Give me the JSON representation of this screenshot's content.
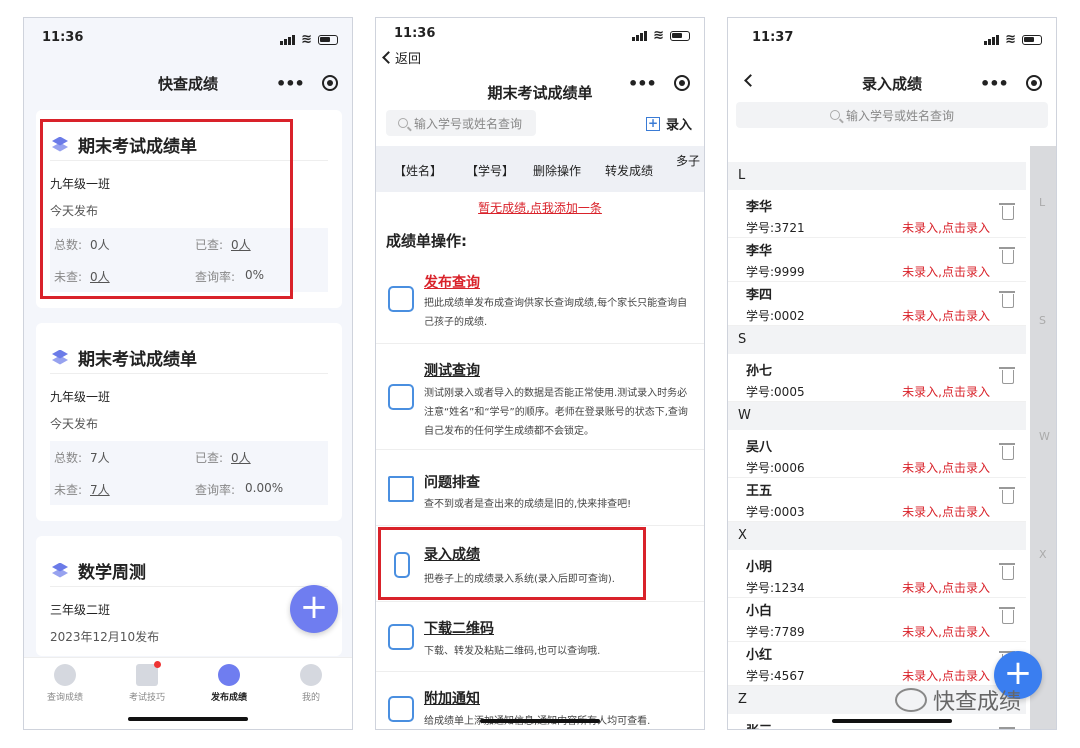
{
  "p1": {
    "time": "11:36",
    "title": "快查成绩",
    "cards": [
      {
        "title": "期末考试成绩单",
        "class": "九年级一班",
        "published": "今天发布",
        "total_label": "总数:",
        "total": "0人",
        "checked_label": "已查:",
        "checked": "0人",
        "unchecked_label": "未查:",
        "unchecked": "0人",
        "rate_label": "查询率:",
        "rate": "0%"
      },
      {
        "title": "期末考试成绩单",
        "class": "九年级一班",
        "published": "今天发布",
        "total_label": "总数:",
        "total": "7人",
        "checked_label": "已查:",
        "checked": "0人",
        "unchecked_label": "未查:",
        "unchecked": "7人",
        "rate_label": "查询率:",
        "rate": "0.00%"
      },
      {
        "title": "数学周测",
        "class": "三年级二班",
        "published": "2023年12月10发布"
      }
    ],
    "tabs": [
      "查询成绩",
      "考试技巧",
      "发布成绩",
      "我的"
    ]
  },
  "p2": {
    "time": "11:36",
    "back": "返回",
    "title": "期末考试成绩单",
    "search_placeholder": "输入学号或姓名查询",
    "add_label": "录入",
    "columns": [
      "【姓名】",
      "【学号】",
      "删除操作",
      "转发成绩",
      "多子"
    ],
    "empty_link": "暂无成绩,点我添加一条",
    "ops_title": "成绩单操作:",
    "ops": [
      {
        "title": "发布查询",
        "desc": "把此成绩单发布成查询供家长查询成绩,每个家长只能查询自己孩子的成绩."
      },
      {
        "title": "测试查询",
        "desc": "测试刚录入或者导入的数据是否能正常使用.测试录入时务必注意“姓名”和“学号”的顺序。老师在登录账号的状态下,查询自己发布的任何学生成绩都不会锁定。"
      },
      {
        "title": "问题排查",
        "desc": "查不到或者是查出来的成绩是旧的,快来排查吧!"
      },
      {
        "title": "录入成绩",
        "desc": "把卷子上的成绩录入系统(录入后即可查询)."
      },
      {
        "title": "下载二维码",
        "desc": "下载、转发及粘贴二维码,也可以查询哦."
      },
      {
        "title": "附加通知",
        "desc": "给成绩单上添加通知信息,通知内容所有人均可查看."
      }
    ]
  },
  "p3": {
    "time": "11:37",
    "title": "录入成绩",
    "search_placeholder": "输入学号或姓名查询",
    "action": "未录入,点击录入",
    "groups": [
      {
        "letter": "L",
        "students": [
          {
            "name": "李华",
            "id": "学号:3721"
          },
          {
            "name": "李华",
            "id": "学号:9999"
          },
          {
            "name": "李四",
            "id": "学号:0002"
          }
        ]
      },
      {
        "letter": "S",
        "students": [
          {
            "name": "孙七",
            "id": "学号:0005"
          }
        ]
      },
      {
        "letter": "W",
        "students": [
          {
            "name": "吴八",
            "id": "学号:0006"
          },
          {
            "name": "王五",
            "id": "学号:0003"
          }
        ]
      },
      {
        "letter": "X",
        "students": [
          {
            "name": "小明",
            "id": "学号:1234"
          },
          {
            "name": "小白",
            "id": "学号:7789"
          },
          {
            "name": "小红",
            "id": "学号:4567"
          }
        ]
      },
      {
        "letter": "Z",
        "students": [
          {
            "name": "张三",
            "id": ""
          }
        ]
      }
    ],
    "index_letters": [
      "L",
      "S",
      "W",
      "X"
    ]
  },
  "watermark": "快查成绩",
  "colors": {
    "accent": "#6f7df0",
    "highlight": "#d9222a",
    "link_blue": "#3a7bd5"
  }
}
